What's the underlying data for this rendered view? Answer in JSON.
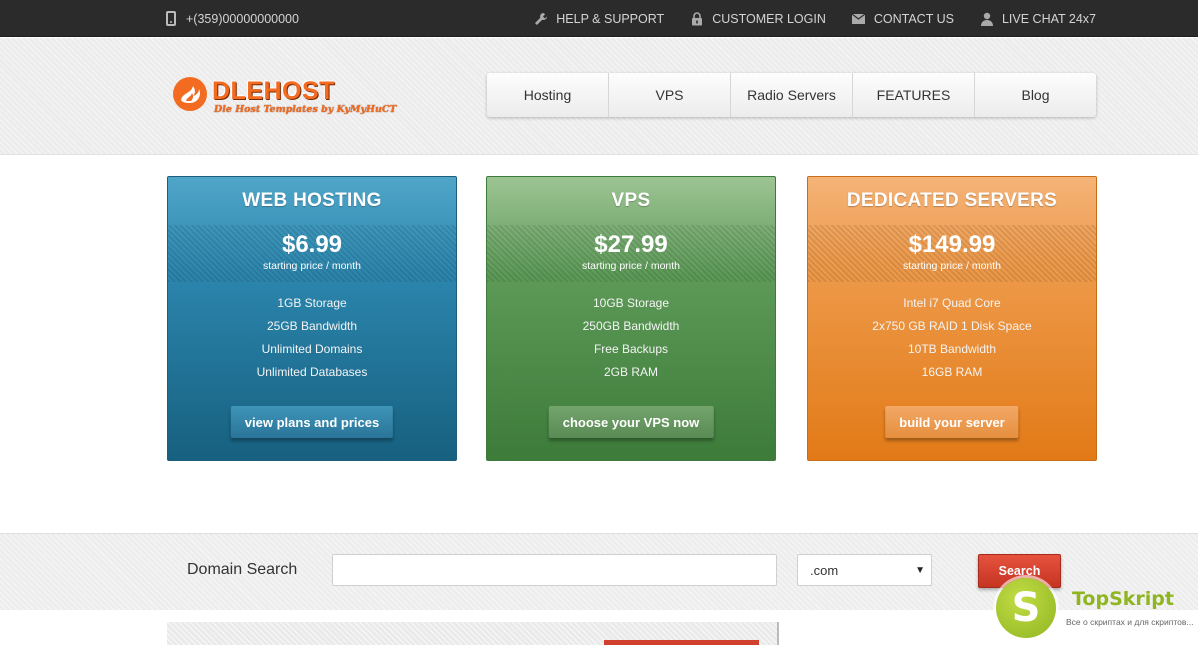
{
  "topbar": {
    "phone": "+(359)00000000000",
    "links": [
      {
        "label": "HELP & SUPPORT",
        "icon": "wrench-icon"
      },
      {
        "label": "CUSTOMER LOGIN",
        "icon": "lock-icon"
      },
      {
        "label": "CONTACT US",
        "icon": "envelope-icon"
      },
      {
        "label": "LIVE CHAT 24x7",
        "icon": "user-icon"
      }
    ]
  },
  "logo": {
    "name": "DLEHOST",
    "tagline": "Dle Host Templates by KyMyHuCT"
  },
  "nav": {
    "items": [
      "Hosting",
      "VPS",
      "Radio Servers",
      "FEATURES",
      "Blog"
    ]
  },
  "plans": [
    {
      "title": "WEB HOSTING",
      "price": "$6.99",
      "price_note": "starting price / month",
      "features": [
        "1GB Storage",
        "25GB Bandwidth",
        "Unlimited Domains",
        "Unlimited Databases"
      ],
      "button": "view plans and prices"
    },
    {
      "title": "VPS",
      "price": "$27.99",
      "price_note": "starting price / month",
      "features": [
        "10GB Storage",
        "250GB Bandwidth",
        "Free Backups",
        "2GB RAM"
      ],
      "button": "choose your VPS now"
    },
    {
      "title": "DEDICATED SERVERS",
      "price": "$149.99",
      "price_note": "starting price / month",
      "features": [
        "Intel i7 Quad Core",
        "2x750 GB RAID 1 Disk Space",
        "10TB Bandwidth",
        "16GB RAM"
      ],
      "button": "build your server"
    }
  ],
  "domain_search": {
    "label": "Domain Search",
    "input_value": "",
    "tld": ".com",
    "button": "Search"
  },
  "watermark": {
    "letter": "S",
    "name": "TopSkript",
    "sub": "Все о скриптах и для скриптов..."
  },
  "colors": {
    "topbar": "#2b2b2b",
    "accent_orange": "#f26b21",
    "web_hosting": "#2b85ad",
    "vps": "#5d9a58",
    "dedicated": "#ee9b4c",
    "search_button": "#d0402e"
  }
}
